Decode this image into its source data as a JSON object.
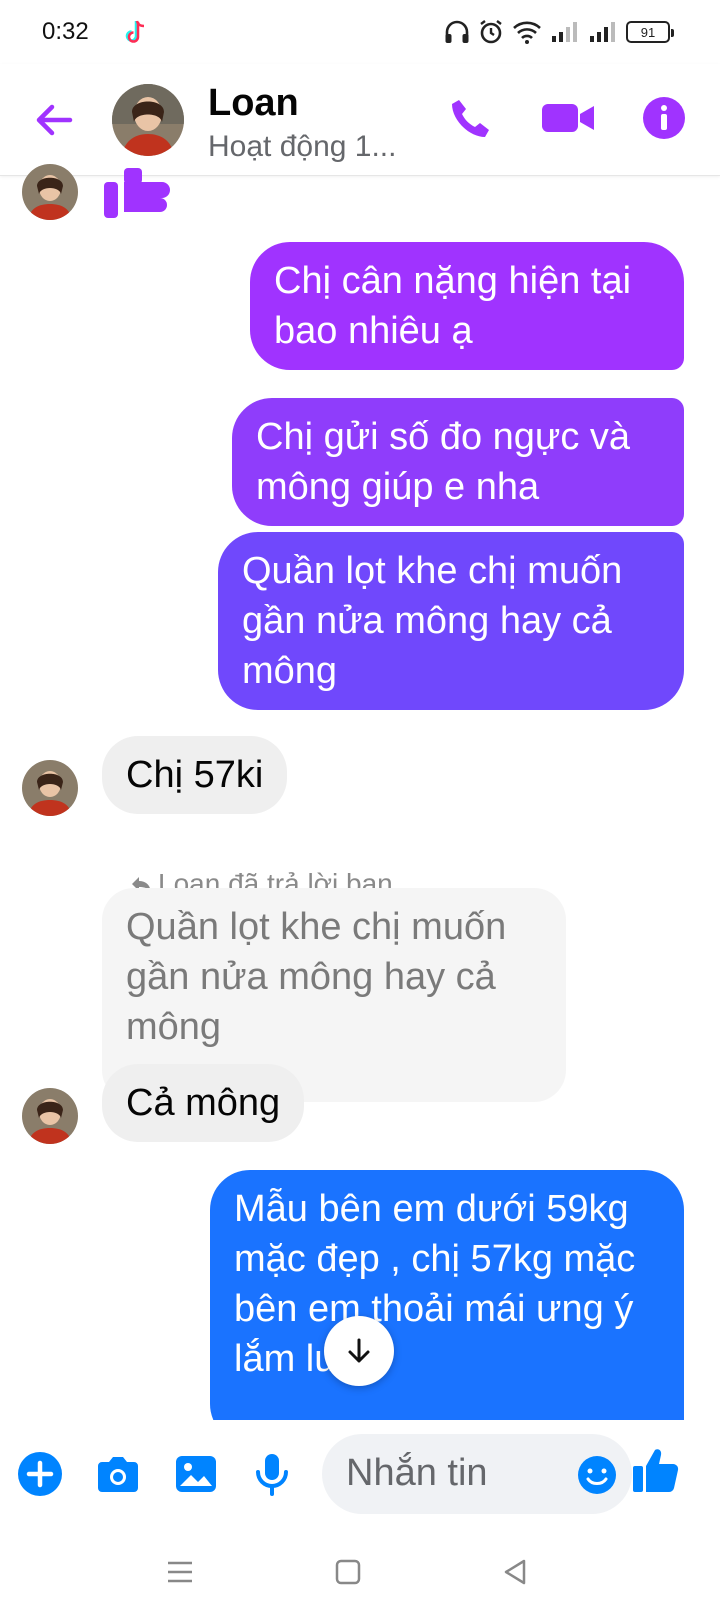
{
  "status_bar": {
    "time": "0:32",
    "battery": "91"
  },
  "header": {
    "name": "Loan",
    "status": "Hoạt động 1..."
  },
  "messages": {
    "m1": "Chị cân nặng hiện tại bao nhiêu ạ",
    "m2": "Chị gửi số đo ngực và mông giúp e nha",
    "m3": "Quần lọt khe chị muốn gần nửa mông hay cả mông",
    "m4": "Chị 57ki",
    "reply_label": "Loan đã trả lời bạn",
    "reply_quote": "Quần lọt khe chị muốn gần nửa mông hay cả mông",
    "m5": "Cả mông",
    "m6": "Mẫu bên em dưới 59kg mặc đẹp , chị 57kg mặc bên em thoải mái ưng ý lắm luôn"
  },
  "composer": {
    "placeholder": "Nhắn tin"
  },
  "colors": {
    "accent": "#a033ff",
    "blue": "#0084ff",
    "gradient_top": "#a033ff",
    "gradient_bottom": "#1a73ff"
  },
  "icons": [
    "back-arrow-icon",
    "phone-icon",
    "video-camera-icon",
    "info-icon",
    "thumbs-up-icon",
    "plus-icon",
    "camera-icon",
    "image-icon",
    "microphone-icon",
    "emoji-icon",
    "arrow-down-icon",
    "reply-arrow-icon",
    "menu-icon",
    "square-icon",
    "triangle-back-icon"
  ]
}
